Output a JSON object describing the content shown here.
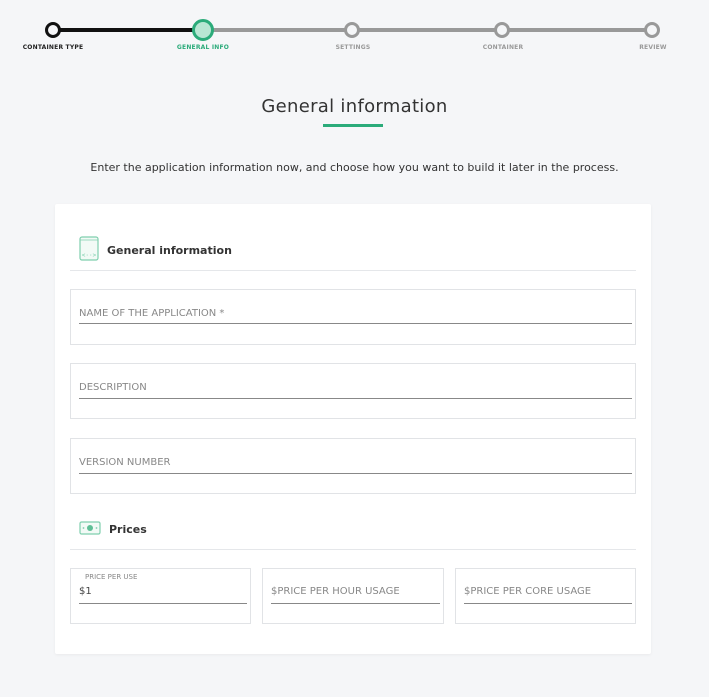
{
  "stepper": {
    "steps": [
      {
        "label": "CONTAINER TYPE"
      },
      {
        "label": "GENERAL INFO"
      },
      {
        "label": "SETTINGS"
      },
      {
        "label": "CONTAINER"
      },
      {
        "label": "REVIEW"
      }
    ],
    "current_step": 2,
    "total_steps": 5
  },
  "header": {
    "title": "General information",
    "intro": "Enter the application information now, and choose how you want to build it later in the process."
  },
  "general_section": {
    "title": "General information",
    "icon": "code-file-icon",
    "fields": {
      "name": {
        "placeholder": "NAME OF THE APPLICATION *",
        "value": ""
      },
      "description": {
        "placeholder": "DESCRIPTION",
        "value": ""
      },
      "version": {
        "placeholder": "VERSION NUMBER",
        "value": ""
      }
    }
  },
  "prices_section": {
    "title": "Prices",
    "icon": "money-icon",
    "fields": {
      "per_use": {
        "label": "PRICE PER USE",
        "value": "$1"
      },
      "per_hour": {
        "placeholder": "$PRICE PER HOUR USAGE",
        "value": ""
      },
      "per_core": {
        "placeholder": "$PRICE PER CORE USAGE",
        "value": ""
      }
    }
  },
  "colors": {
    "accent": "#2bab7a",
    "background": "#f5f6f8",
    "completed": "#111111",
    "pending": "#999999"
  }
}
